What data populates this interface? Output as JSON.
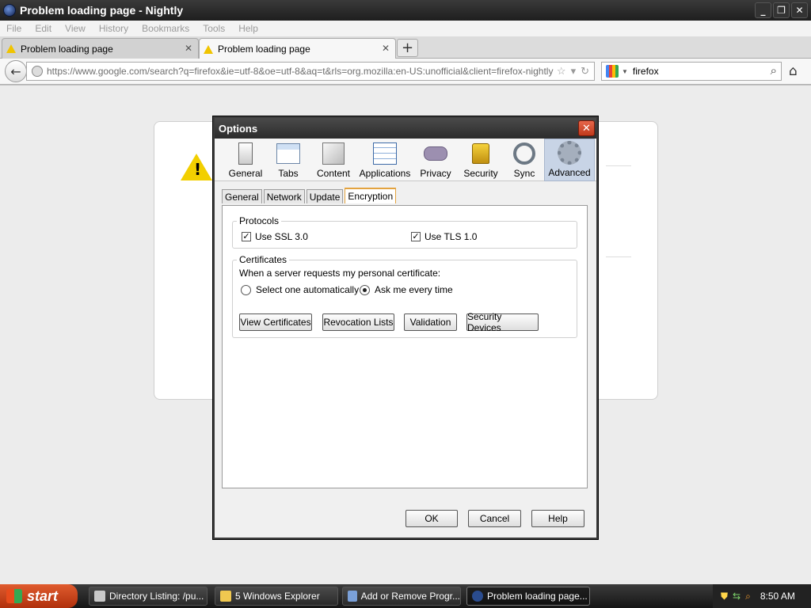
{
  "window": {
    "title": "Problem loading page - Nightly"
  },
  "menu": [
    "File",
    "Edit",
    "View",
    "History",
    "Bookmarks",
    "Tools",
    "Help"
  ],
  "tabs": [
    {
      "label": "Problem loading page",
      "active": false
    },
    {
      "label": "Problem loading page",
      "active": true
    }
  ],
  "navbar": {
    "url": "https://www.google.com/search?q=firefox&ie=utf-8&oe=utf-8&aq=t&rls=org.mozilla:en-US:unofficial&client=firefox-nightly",
    "search_value": "firefox"
  },
  "dialog": {
    "title": "Options",
    "panes": [
      "General",
      "Tabs",
      "Content",
      "Applications",
      "Privacy",
      "Security",
      "Sync",
      "Advanced"
    ],
    "selected_pane": "Advanced",
    "subtabs": [
      "General",
      "Network",
      "Update",
      "Encryption"
    ],
    "selected_subtab": "Encryption",
    "protocols": {
      "legend": "Protocols",
      "ssl_label": "Use SSL 3.0",
      "ssl_checked": true,
      "tls_label": "Use TLS 1.0",
      "tls_checked": true
    },
    "certificates": {
      "legend": "Certificates",
      "prompt": "When a server requests my personal certificate:",
      "radio_auto": "Select one automatically",
      "radio_ask": "Ask me every time",
      "selected": "Ask me every time",
      "buttons": [
        "View Certificates",
        "Revocation Lists",
        "Validation",
        "Security Devices"
      ]
    },
    "footer": {
      "ok": "OK",
      "cancel": "Cancel",
      "help": "Help"
    }
  },
  "taskbar": {
    "start": "start",
    "tasks": [
      "Directory Listing: /pu...",
      "5 Windows Explorer",
      "Add or Remove Progr...",
      "Problem loading page..."
    ],
    "active_task": "Problem loading page...",
    "clock": "8:50 AM"
  },
  "icons": {
    "back": "back-arrow-icon",
    "home": "home-icon",
    "search": "magnifier-icon",
    "bookmark": "star-icon",
    "reload": "reload-icon"
  },
  "colors": {
    "accent_tab": "#e3a33f",
    "selected_pane": "#c8d4e6",
    "dialog_close": "#d04a2a",
    "warning": "#f2cf00"
  }
}
